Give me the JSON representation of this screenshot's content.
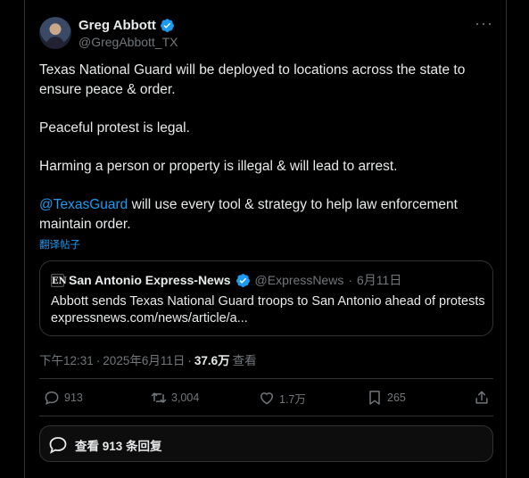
{
  "author": {
    "name": "Greg Abbott",
    "handle": "@GregAbbott_TX",
    "verified_color": "#1d9bf0"
  },
  "more_icon": "more-horizontal-icon",
  "tweet": {
    "paragraphs": [
      "Texas National Guard will be deployed to locations across the state to ensure peace & order.",
      "Peaceful protest is legal.",
      "Harming a person or property is illegal & will lead to arrest."
    ],
    "mention": "@TexasGuard",
    "last_paragraph_rest": " will use every tool & strategy to help law enforcement maintain order.",
    "translate_label": "翻译帖子"
  },
  "quote": {
    "source_logo": "EN",
    "source_name": "San Antonio Express-News",
    "source_handle": "@ExpressNews",
    "separator": "·",
    "date": "6月11日",
    "title": "Abbott sends Texas National Guard troops to San Antonio ahead of protests",
    "link": "expressnews.com/news/article/a..."
  },
  "meta": {
    "time": "下午12:31",
    "separator": "·",
    "date": "2025年6月11日",
    "separator2": "·",
    "views": "37.6万",
    "views_label": "查看"
  },
  "actions": {
    "reply_count": "913",
    "retweet_count": "3,004",
    "like_count": "1.7万",
    "bookmark_count": "265"
  },
  "replies_button": {
    "label": "查看 913 条回复"
  },
  "colors": {
    "accent": "#1d9bf0",
    "background": "#000000",
    "muted": "#71767b",
    "border": "#2f3336"
  }
}
